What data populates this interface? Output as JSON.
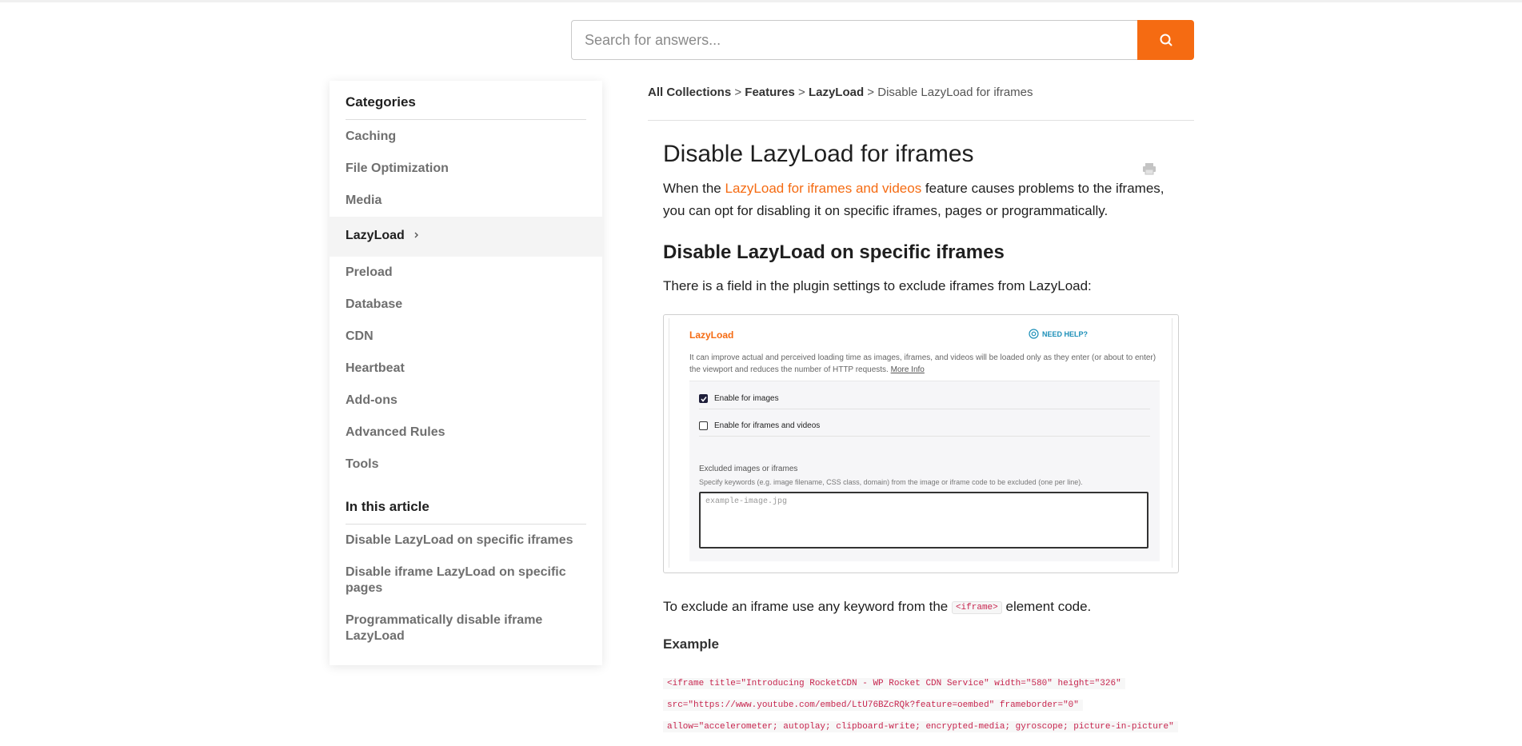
{
  "search": {
    "placeholder": "Search for answers..."
  },
  "sidebar": {
    "categories_heading": "Categories",
    "categories": [
      {
        "label": "Caching"
      },
      {
        "label": "File Optimization"
      },
      {
        "label": "Media"
      },
      {
        "label": "LazyLoad",
        "active": true
      },
      {
        "label": "Preload"
      },
      {
        "label": "Database"
      },
      {
        "label": "CDN"
      },
      {
        "label": "Heartbeat"
      },
      {
        "label": "Add-ons"
      },
      {
        "label": "Advanced Rules"
      },
      {
        "label": "Tools"
      }
    ],
    "toc_heading": "In this article",
    "toc": [
      {
        "label": "Disable LazyLoad on specific iframes"
      },
      {
        "label": "Disable iframe LazyLoad on specific pages"
      },
      {
        "label": "Programmatically disable iframe LazyLoad"
      }
    ]
  },
  "breadcrumb": {
    "items": [
      "All Collections",
      "Features",
      "LazyLoad"
    ],
    "separator": ">",
    "current": "Disable LazyLoad for iframes"
  },
  "article": {
    "title": "Disable LazyLoad for iframes",
    "intro_before": "When the ",
    "intro_link": "LazyLoad for iframes and videos",
    "intro_after": " feature causes problems to the iframes, you can opt for disabling it on specific iframes, pages or programmatically.",
    "section1_heading": "Disable LazyLoad on specific iframes",
    "section1_text": "There is a field in the plugin settings to exclude iframes from LazyLoad:",
    "exclude_before": "To exclude an iframe use any keyword from the ",
    "exclude_code": "<iframe>",
    "exclude_after": " element code.",
    "example_heading": "Example",
    "code_lines": [
      "<iframe title=\"Introducing RocketCDN - WP Rocket CDN Service\" width=\"580\" height=\"326\"",
      "src=\"https://www.youtube.com/embed/LtU76BZcRQk?feature=oembed\" frameborder=\"0\"",
      "allow=\"accelerometer; autoplay; clipboard-write; encrypted-media; gyroscope; picture-in-picture\""
    ]
  },
  "screenshot": {
    "title": "LazyLoad",
    "help": "NEED HELP?",
    "description": "It can improve actual and perceived loading time as images, iframes, and videos will be loaded only as they enter (or about to enter) the viewport and reduces the number of HTTP requests.",
    "more_info": "More Info",
    "option_images": "Enable for images",
    "option_images_checked": true,
    "option_iframes": "Enable for iframes and videos",
    "option_iframes_checked": false,
    "excluded_label": "Excluded images or iframes",
    "excluded_help": "Specify keywords (e.g. image filename, CSS class, domain) from the image or iframe code to be excluded (one per line).",
    "excluded_placeholder": "example-image.jpg"
  },
  "colors": {
    "accent": "#f56b12",
    "help_link": "#1c8fb8",
    "code": "#c7254e"
  }
}
